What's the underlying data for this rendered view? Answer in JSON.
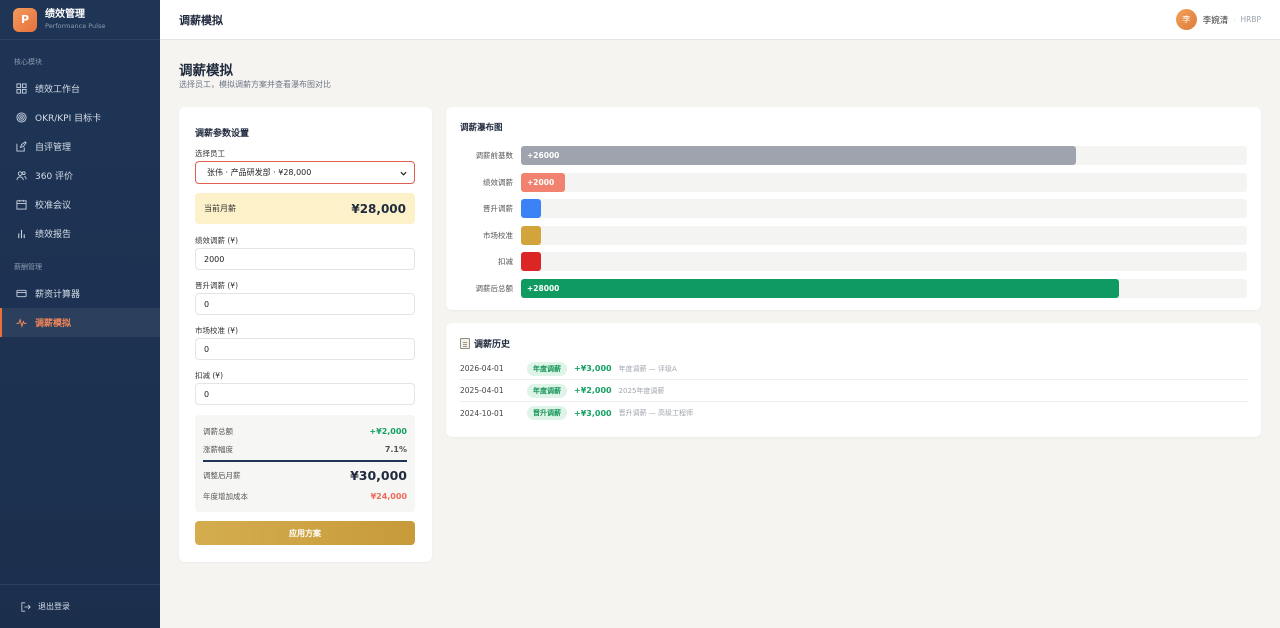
{
  "brand": {
    "logo": "P",
    "title": "绩效管理",
    "subtitle": "Performance Pulse"
  },
  "sidebar": {
    "sections": [
      {
        "label": "核心模块",
        "items": [
          {
            "label": "绩效工作台",
            "icon": "grid-icon"
          },
          {
            "label": "OKR/KPI 目标卡",
            "icon": "target-icon"
          },
          {
            "label": "自评管理",
            "icon": "edit-icon"
          },
          {
            "label": "360 评价",
            "icon": "users-icon"
          },
          {
            "label": "校准会议",
            "icon": "calendar-icon"
          },
          {
            "label": "绩效报告",
            "icon": "bar-chart-icon"
          }
        ]
      },
      {
        "label": "薪酬管理",
        "items": [
          {
            "label": "薪资计算器",
            "icon": "card-icon"
          },
          {
            "label": "调薪模拟",
            "icon": "pulse-icon",
            "active": true
          }
        ]
      }
    ],
    "logout": "退出登录"
  },
  "topbar": {
    "title": "调薪模拟",
    "user": {
      "avatar": "李",
      "name": "李婉清",
      "separator": "·",
      "role": "HRBP"
    }
  },
  "page": {
    "title": "调薪模拟",
    "subtitle": "选择员工，模拟调薪方案并查看瀑布图对比"
  },
  "params": {
    "title": "调薪参数设置",
    "employee_label": "选择员工",
    "employee_value": "张伟 · 产品研发部 · ¥28,000",
    "current_label": "当前月薪",
    "current_value": "¥28,000",
    "fields": [
      {
        "label": "绩效调薪 (¥)",
        "value": "2000"
      },
      {
        "label": "晋升调薪 (¥)",
        "value": "0"
      },
      {
        "label": "市场校准 (¥)",
        "value": "0"
      },
      {
        "label": "扣减 (¥)",
        "value": "0"
      }
    ],
    "summary": {
      "total_label": "调薪总额",
      "total_value": "+¥2,000",
      "rate_label": "涨薪幅度",
      "rate_value": "7.1%",
      "new_label": "调整后月薪",
      "new_value": "¥30,000",
      "cost_label": "年度增加成本",
      "cost_value": "¥24,000"
    },
    "apply_label": "应用方案"
  },
  "chart_data": {
    "type": "bar",
    "title": "调薪瀑布图",
    "categories": [
      "调薪前基数",
      "绩效调薪",
      "晋升调薪",
      "市场校准",
      "扣减",
      "调薪后总额"
    ],
    "values": [
      26000,
      2000,
      0,
      0,
      0,
      28000
    ],
    "data_labels": [
      "+26000",
      "+2000",
      "",
      "",
      "",
      "+28000"
    ],
    "xlim": [
      0,
      34000
    ],
    "colors": [
      "#9ea3ad",
      "#f0826f",
      "#3b82f6",
      "#d4a43c",
      "#dc2626",
      "#0f9a61"
    ]
  },
  "history": {
    "title": "调薪历史",
    "rows": [
      {
        "date": "2026-04-01",
        "tag": "年度调薪",
        "amount": "+¥3,000",
        "note": "年度调薪 — 评级A"
      },
      {
        "date": "2025-04-01",
        "tag": "年度调薪",
        "amount": "+¥2,000",
        "note": "2025年度调薪"
      },
      {
        "date": "2024-10-01",
        "tag": "晋升调薪",
        "amount": "+¥3,000",
        "note": "晋升调薪 — 高级工程师"
      }
    ]
  }
}
